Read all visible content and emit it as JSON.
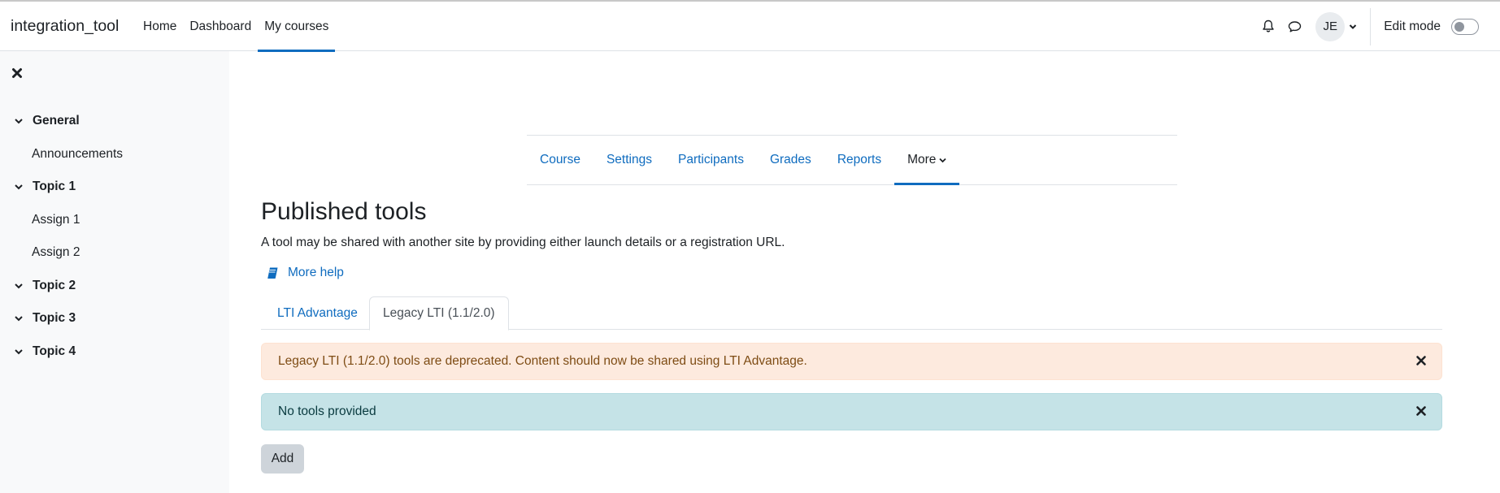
{
  "navbar": {
    "brand": "integration_tool",
    "items": [
      {
        "label": "Home"
      },
      {
        "label": "Dashboard"
      },
      {
        "label": "My courses"
      }
    ],
    "active_item": "My courses",
    "avatar_initials": "JE",
    "edit_mode_label": "Edit mode",
    "edit_mode_on": false,
    "icons": [
      "bell-icon",
      "chat-icon",
      "chevron-down-icon"
    ]
  },
  "drawer": {
    "close_icon": "close-icon",
    "sections": [
      {
        "title": "General",
        "items": [
          {
            "label": "Announcements"
          }
        ]
      },
      {
        "title": "Topic 1",
        "items": [
          {
            "label": "Assign 1"
          },
          {
            "label": "Assign 2"
          }
        ]
      },
      {
        "title": "Topic 2",
        "items": []
      },
      {
        "title": "Topic 3",
        "items": []
      },
      {
        "title": "Topic 4",
        "items": []
      }
    ]
  },
  "secondary_nav": {
    "items": [
      {
        "label": "Course"
      },
      {
        "label": "Settings"
      },
      {
        "label": "Participants"
      },
      {
        "label": "Grades"
      },
      {
        "label": "Reports"
      },
      {
        "label": "More"
      }
    ],
    "active_item": "More"
  },
  "main": {
    "title": "Published tools",
    "description": "A tool may be shared with another site by providing either launch details or a registration URL.",
    "help_link": "More help",
    "tabs": [
      {
        "label": "LTI Advantage"
      },
      {
        "label": "Legacy LTI (1.1/2.0)"
      }
    ],
    "active_tab": "Legacy LTI (1.1/2.0)",
    "alerts": {
      "warning": "Legacy LTI (1.1/2.0) tools are deprecated. Content should now be shared using LTI Advantage.",
      "info": "No tools provided"
    },
    "add_button": "Add"
  },
  "colors": {
    "link": "#0f6cbf",
    "drawer_bg": "#f8f9fa",
    "warning_bg": "#fdeade",
    "warning_text": "#7e4c14",
    "info_bg": "#c5e3e7",
    "info_text": "#093a3f",
    "button_bg": "#ced4da"
  }
}
